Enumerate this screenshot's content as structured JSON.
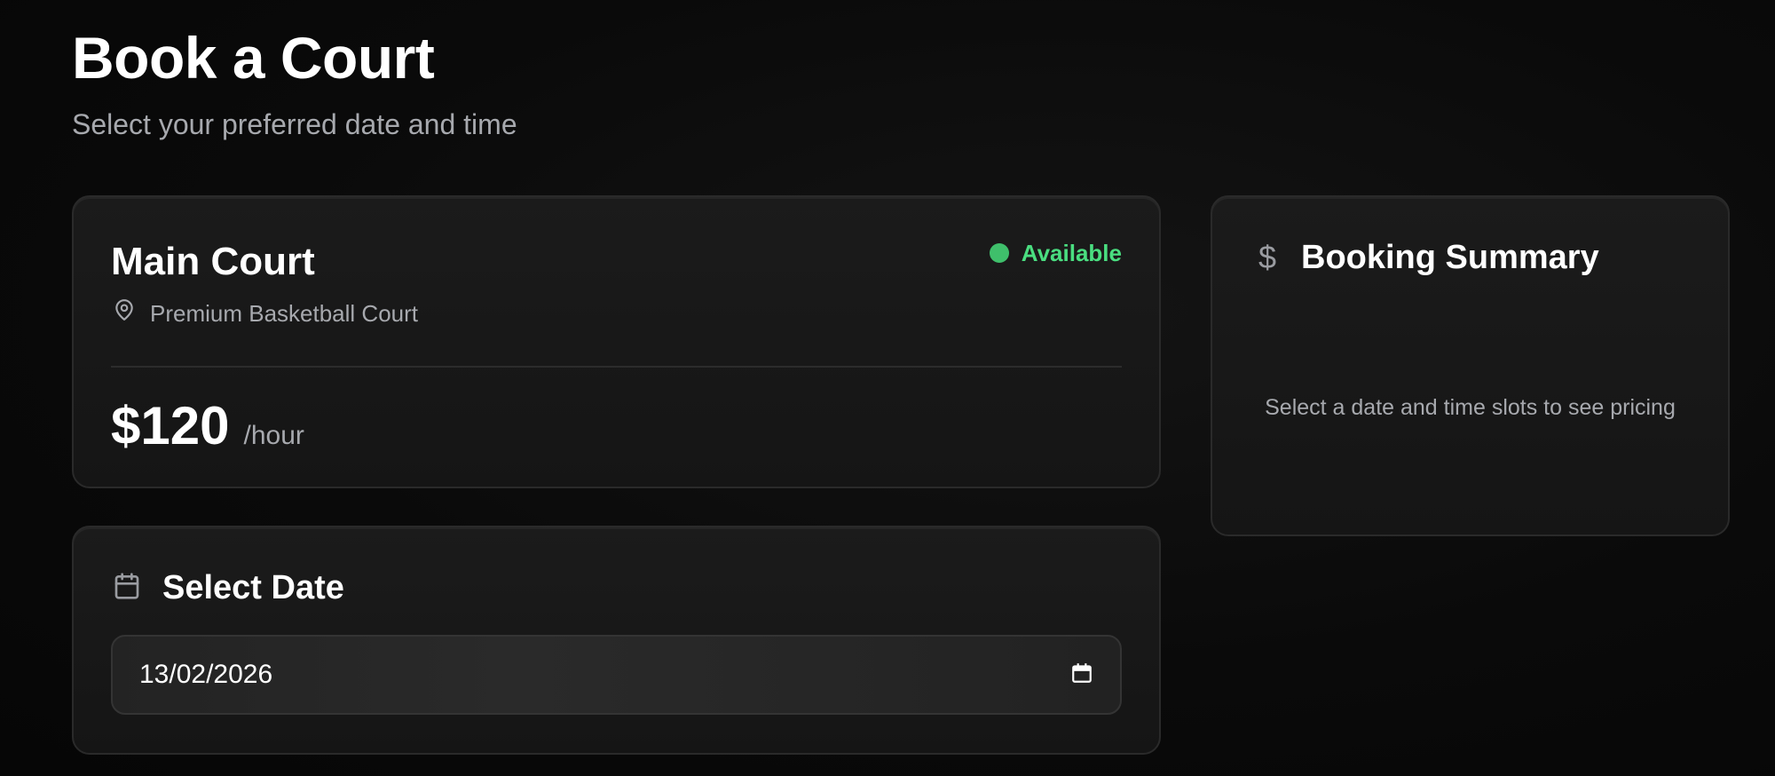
{
  "page": {
    "title": "Book a Court",
    "subtitle": "Select your preferred date and time"
  },
  "court": {
    "name": "Main Court",
    "location": "Premium Basketball Court",
    "status": "Available",
    "price": "$120",
    "price_unit": "/hour"
  },
  "date_picker": {
    "title": "Select Date",
    "value": "13/02/2026"
  },
  "summary": {
    "title": "Booking Summary",
    "empty_message": "Select a date and time slots to see pricing",
    "currency_symbol": "$"
  },
  "icons": {
    "location": "map-pin-icon",
    "calendar": "calendar-icon",
    "date_input": "calendar-picker-icon",
    "summary": "dollar-sign-icon"
  },
  "colors": {
    "background": "#0a0a0a",
    "card": "#171717",
    "available": "#4ade80",
    "muted_text": "#a7a9ae"
  }
}
